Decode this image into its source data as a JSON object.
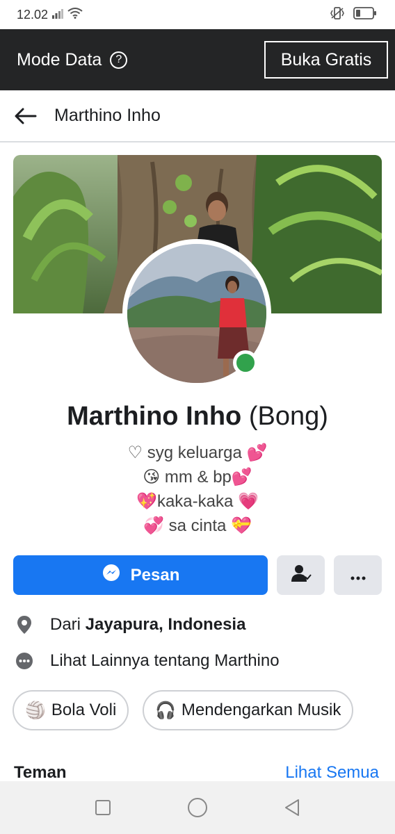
{
  "status": {
    "time": "12.02",
    "icons": [
      "signal-icon",
      "wifi-icon",
      "vibrate-icon",
      "battery-icon"
    ]
  },
  "modebar": {
    "title": "Mode Data",
    "help_icon": "?",
    "button": "Buka Gratis"
  },
  "header": {
    "back_icon": "arrow-left-icon",
    "title": "Marthino Inho"
  },
  "profile": {
    "name": "Marthino Inho",
    "alt_name": "(Bong)",
    "bio": [
      {
        "pre": "♡ syg keluarga ",
        "emoji": "💕"
      },
      {
        "pre": "😘 mm & bp",
        "emoji": "💕"
      },
      {
        "pre": "💖kaka-kaka ",
        "emoji": "💗"
      },
      {
        "pre": "💞 sa cinta ",
        "emoji": "💝"
      }
    ],
    "online_color": "#31a24c"
  },
  "actions": {
    "message_label": "Pesan",
    "primary_color": "#1877f2"
  },
  "info": {
    "location_prefix": "Dari ",
    "location": "Jayapura, Indonesia",
    "see_more": "Lihat Lainnya tentang Marthino"
  },
  "interests": [
    {
      "label": "Bola Voli",
      "emoji": "🏐"
    },
    {
      "label": "Mendengarkan Musik",
      "emoji": "🎧"
    }
  ],
  "friends": {
    "title": "Teman",
    "link": "Lihat Semua"
  }
}
